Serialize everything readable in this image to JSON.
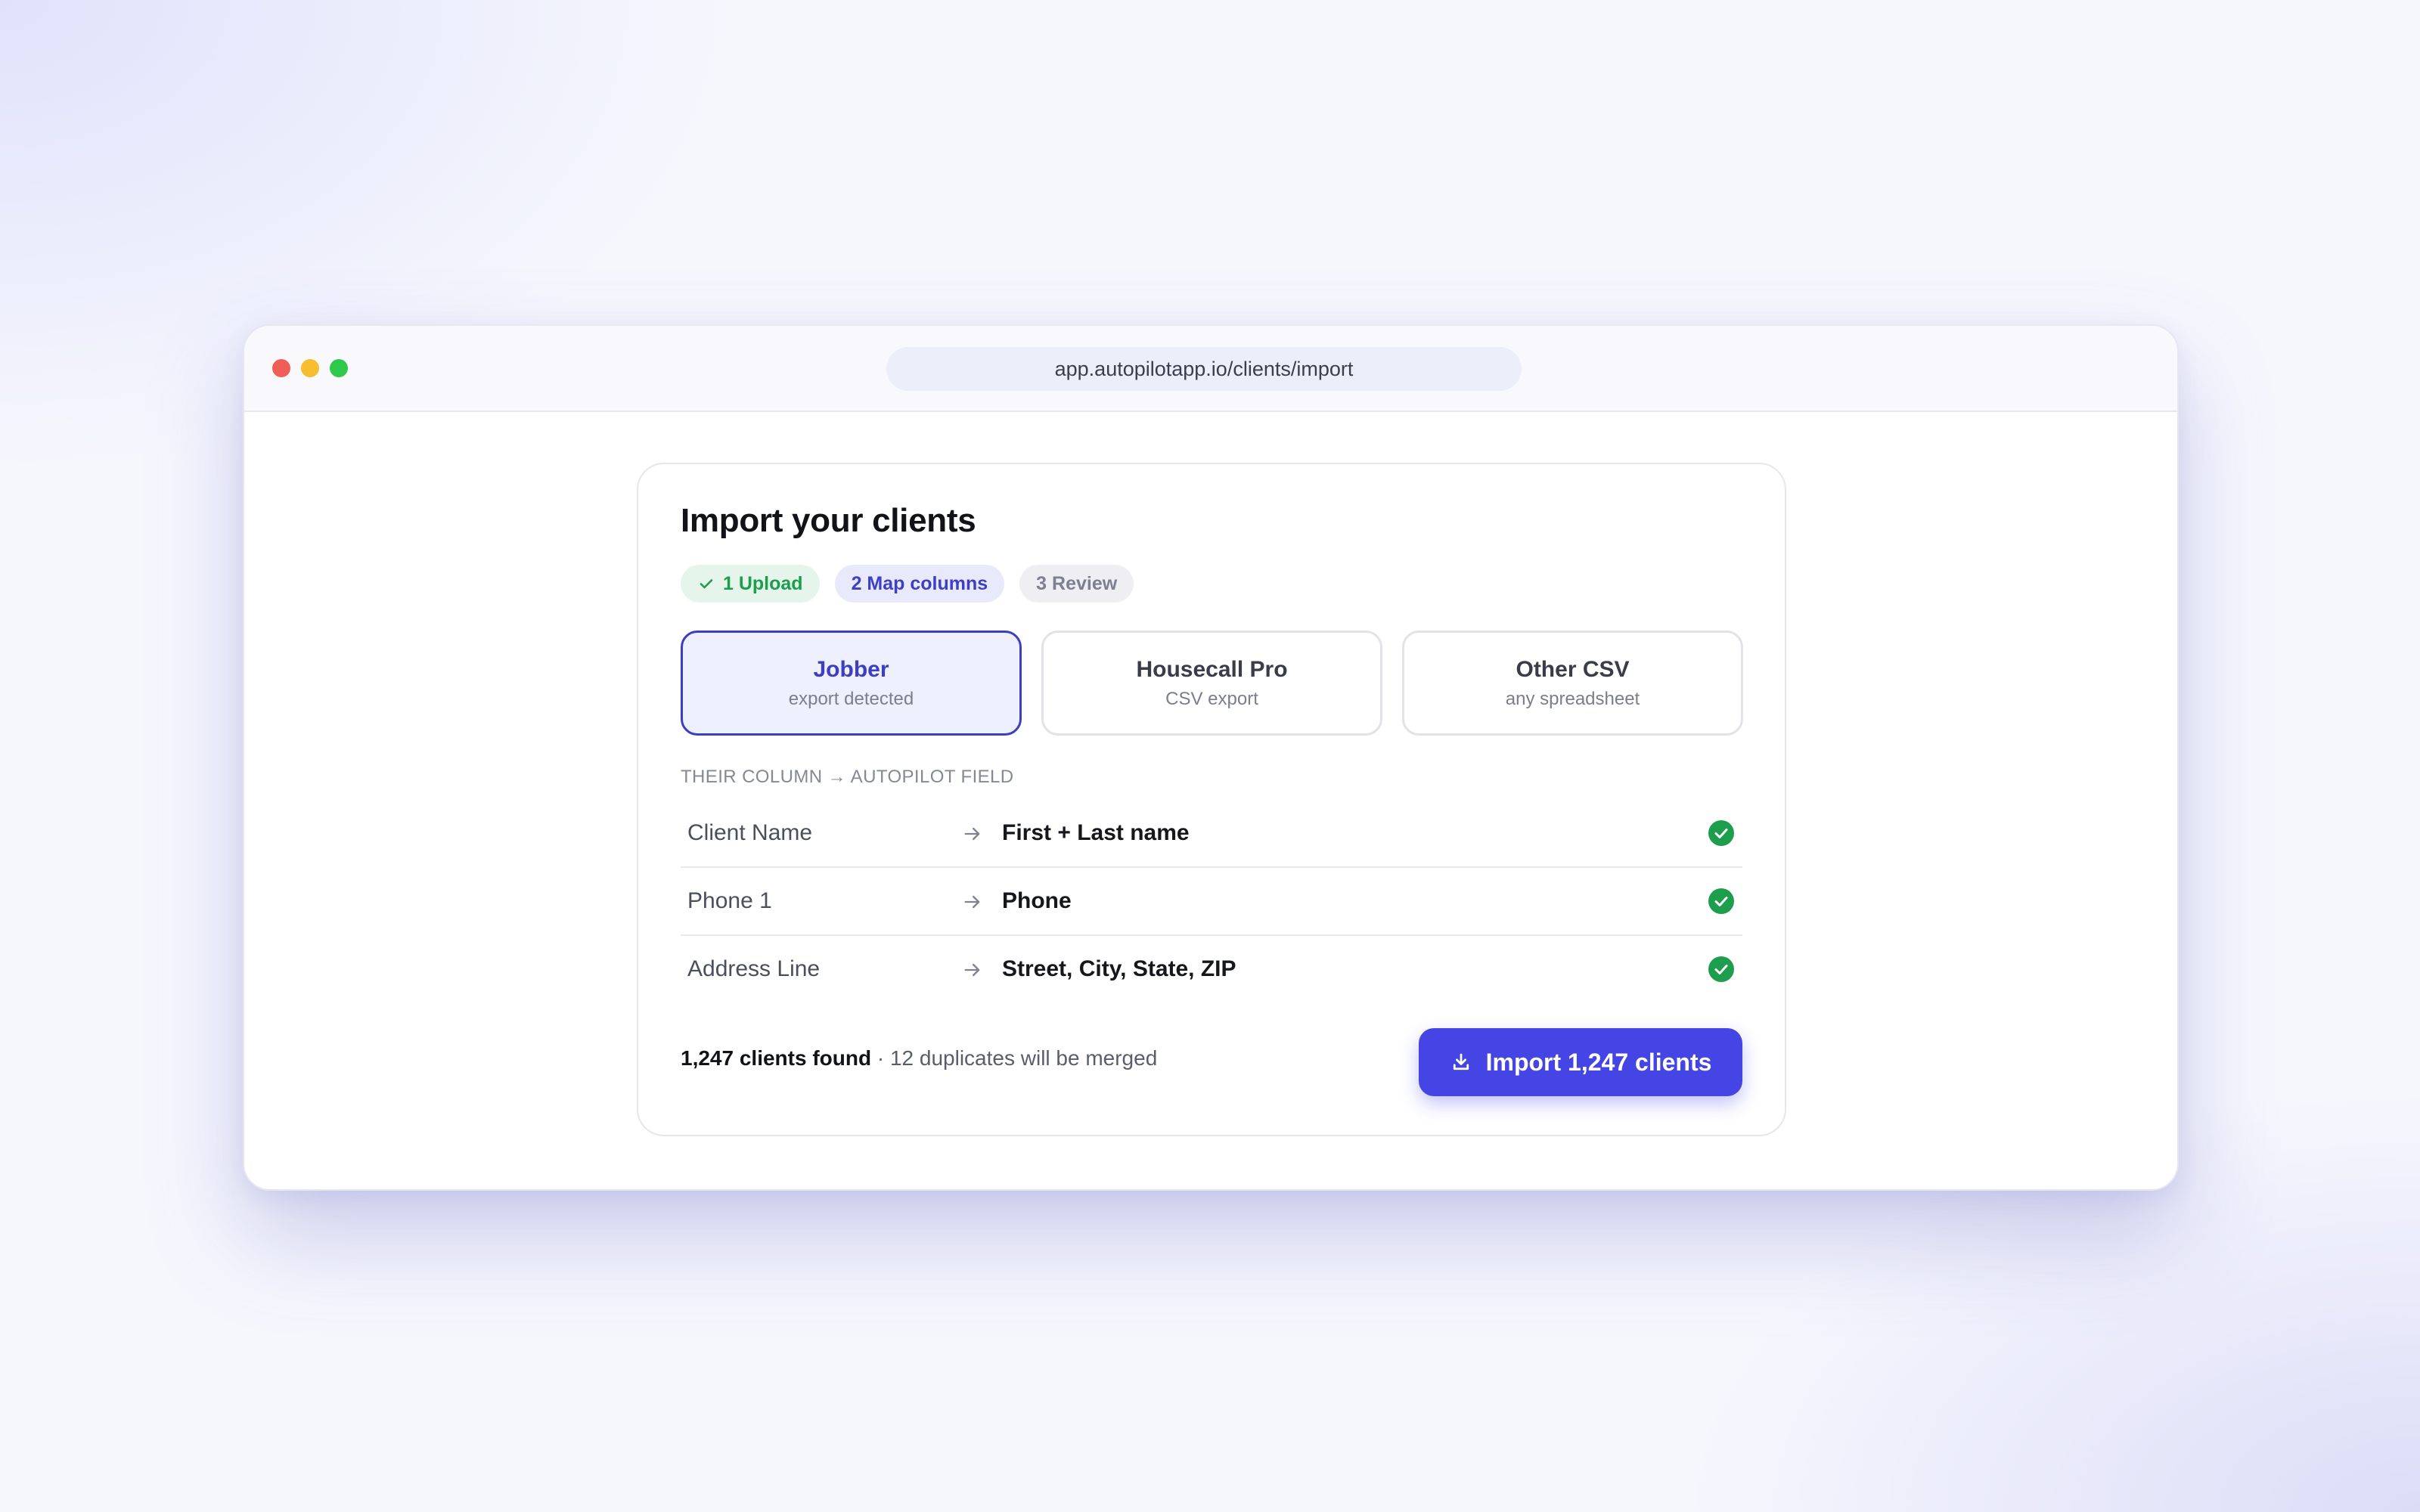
{
  "browser": {
    "url": "app.autopilotapp.io/clients/import"
  },
  "page": {
    "title": "Import your clients"
  },
  "steps": [
    {
      "label": "1 Upload",
      "state": "done"
    },
    {
      "label": "2 Map columns",
      "state": "active"
    },
    {
      "label": "3 Review",
      "state": "todo"
    }
  ],
  "sources": [
    {
      "name": "Jobber",
      "sub": "export detected",
      "selected": true
    },
    {
      "name": "Housecall Pro",
      "sub": "CSV export",
      "selected": false
    },
    {
      "name": "Other CSV",
      "sub": "any spreadsheet",
      "selected": false
    }
  ],
  "mapping": {
    "header": "THEIR COLUMN → AUTOPILOT FIELD",
    "rows": [
      {
        "their": "Client Name",
        "field": "First + Last name",
        "status_icon": "check-circle-icon"
      },
      {
        "their": "Phone 1",
        "field": "Phone",
        "status_icon": "check-circle-icon"
      },
      {
        "their": "Address Line",
        "field": "Street, City, State, ZIP",
        "status_icon": "check-circle-icon"
      }
    ]
  },
  "footer": {
    "clients_found": "1,247 clients found",
    "separator": " · ",
    "duplicates": "12 duplicates will be merged",
    "import_label": "Import 1,247 clients"
  },
  "colors": {
    "accent": "#4545e6",
    "selected_border": "#3c3fbf",
    "success": "#1c9e4c",
    "traffic_red": "#ef5f57",
    "traffic_yellow": "#f6be2f",
    "traffic_green": "#2ec84a"
  }
}
